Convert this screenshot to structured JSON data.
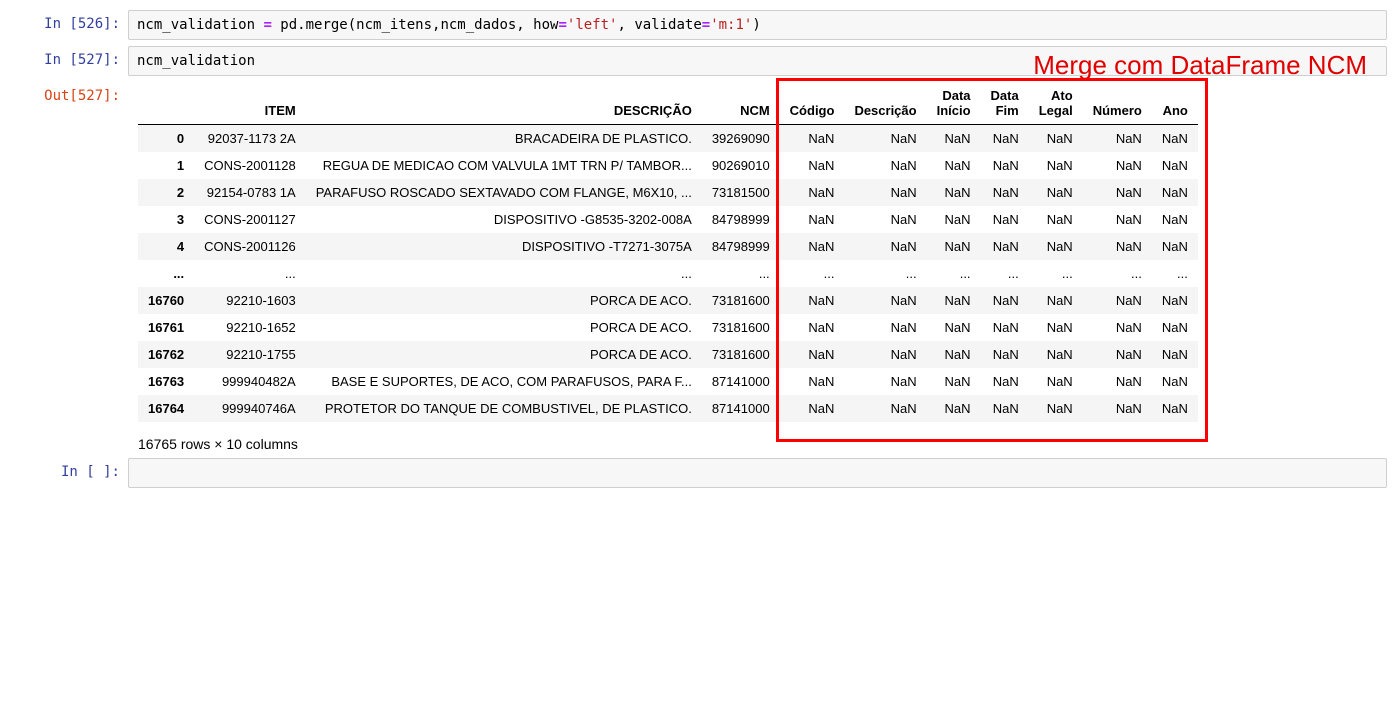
{
  "cells": {
    "c1": {
      "prompt": "In [526]:",
      "code": {
        "var1": "ncm_validation ",
        "op": "=",
        "call": " pd.merge(ncm_itens,ncm_dados, how",
        "eq1": "=",
        "str1": "'left'",
        "c1": ", validate",
        "eq2": "=",
        "str2": "'m:1'",
        "tail": ")"
      }
    },
    "c2": {
      "prompt": "In [527]:",
      "code_text": "ncm_validation"
    },
    "c3": {
      "prompt": "Out[527]:"
    },
    "c4": {
      "prompt": "In [ ]:"
    }
  },
  "annotation": "Merge com DataFrame NCM",
  "table": {
    "headers": [
      "",
      "ITEM",
      "DESCRIÇÃO",
      "NCM",
      "Código",
      "Descrição",
      "Data Início",
      "Data Fim",
      "Ato Legal",
      "Número",
      "Ano"
    ],
    "rows": [
      {
        "idx": "0",
        "item": "92037-1173 2A",
        "desc": "BRACADEIRA DE PLASTICO.",
        "ncm": "39269090",
        "codigo": "NaN",
        "descr": "NaN",
        "di": "NaN",
        "df": "NaN",
        "al": "NaN",
        "num": "NaN",
        "ano": "NaN"
      },
      {
        "idx": "1",
        "item": "CONS-2001128",
        "desc": "REGUA DE MEDICAO COM VALVULA 1MT TRN P/ TAMBOR...",
        "ncm": "90269010",
        "codigo": "NaN",
        "descr": "NaN",
        "di": "NaN",
        "df": "NaN",
        "al": "NaN",
        "num": "NaN",
        "ano": "NaN"
      },
      {
        "idx": "2",
        "item": "92154-0783 1A",
        "desc": "PARAFUSO ROSCADO SEXTAVADO COM FLANGE, M6X10, ...",
        "ncm": "73181500",
        "codigo": "NaN",
        "descr": "NaN",
        "di": "NaN",
        "df": "NaN",
        "al": "NaN",
        "num": "NaN",
        "ano": "NaN"
      },
      {
        "idx": "3",
        "item": "CONS-2001127",
        "desc": "DISPOSITIVO -G8535-3202-008A",
        "ncm": "84798999",
        "codigo": "NaN",
        "descr": "NaN",
        "di": "NaN",
        "df": "NaN",
        "al": "NaN",
        "num": "NaN",
        "ano": "NaN"
      },
      {
        "idx": "4",
        "item": "CONS-2001126",
        "desc": "DISPOSITIVO -T7271-3075A",
        "ncm": "84798999",
        "codigo": "NaN",
        "descr": "NaN",
        "di": "NaN",
        "df": "NaN",
        "al": "NaN",
        "num": "NaN",
        "ano": "NaN"
      },
      {
        "idx": "...",
        "item": "...",
        "desc": "...",
        "ncm": "...",
        "codigo": "...",
        "descr": "...",
        "di": "...",
        "df": "...",
        "al": "...",
        "num": "...",
        "ano": "..."
      },
      {
        "idx": "16760",
        "item": "92210-1603",
        "desc": "PORCA DE ACO.",
        "ncm": "73181600",
        "codigo": "NaN",
        "descr": "NaN",
        "di": "NaN",
        "df": "NaN",
        "al": "NaN",
        "num": "NaN",
        "ano": "NaN"
      },
      {
        "idx": "16761",
        "item": "92210-1652",
        "desc": "PORCA DE ACO.",
        "ncm": "73181600",
        "codigo": "NaN",
        "descr": "NaN",
        "di": "NaN",
        "df": "NaN",
        "al": "NaN",
        "num": "NaN",
        "ano": "NaN"
      },
      {
        "idx": "16762",
        "item": "92210-1755",
        "desc": "PORCA DE ACO.",
        "ncm": "73181600",
        "codigo": "NaN",
        "descr": "NaN",
        "di": "NaN",
        "df": "NaN",
        "al": "NaN",
        "num": "NaN",
        "ano": "NaN"
      },
      {
        "idx": "16763",
        "item": "999940482A",
        "desc": "BASE E SUPORTES, DE ACO, COM PARAFUSOS, PARA F...",
        "ncm": "87141000",
        "codigo": "NaN",
        "descr": "NaN",
        "di": "NaN",
        "df": "NaN",
        "al": "NaN",
        "num": "NaN",
        "ano": "NaN"
      },
      {
        "idx": "16764",
        "item": "999940746A",
        "desc": "PROTETOR DO TANQUE DE COMBUSTIVEL, DE PLASTICO.",
        "ncm": "87141000",
        "codigo": "NaN",
        "descr": "NaN",
        "di": "NaN",
        "df": "NaN",
        "al": "NaN",
        "num": "NaN",
        "ano": "NaN"
      }
    ],
    "caption": "16765 rows × 10 columns"
  }
}
